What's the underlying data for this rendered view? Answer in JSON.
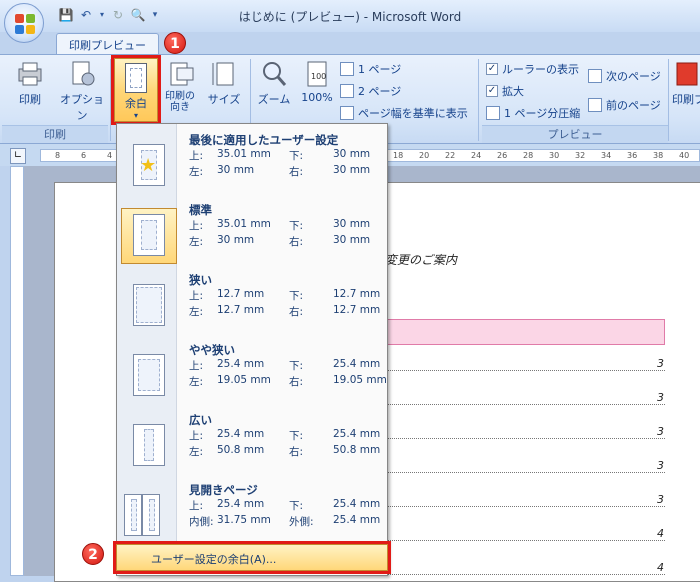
{
  "window": {
    "title": "はじめに (プレビュー) - Microsoft Word"
  },
  "tab": {
    "label": "印刷プレビュー"
  },
  "ribbon": {
    "print_group": {
      "label": "印刷",
      "print": "印刷",
      "options": "オプション"
    },
    "page_setup": {
      "margins": "余白",
      "orientation": "印刷の\n向き",
      "size": "サイズ"
    },
    "zoom_group": {
      "zoom": "ズーム",
      "percent": "100%",
      "one_page": "1 ページ",
      "two_pages": "2 ページ",
      "page_width": "ページ幅を基準に表示"
    },
    "preview_group": {
      "label": "プレビュー",
      "show_ruler": "ルーラーの表示",
      "magnifier": "拡大",
      "shrink_one_page": "1 ページ分圧縮",
      "next_page": "次のページ",
      "prev_page": "前のページ",
      "print_preview_close": "印刷プ"
    }
  },
  "ruler": {
    "ticks": [
      "8",
      "6",
      "4",
      "2",
      "",
      "2",
      "4",
      "6",
      "8",
      "10",
      "12",
      "14",
      "16",
      "18",
      "20",
      "22",
      "24",
      "26",
      "28",
      "30",
      "32",
      "34",
      "36",
      "38",
      "40",
      "42"
    ]
  },
  "document": {
    "notice_text": "ス変更のご案内",
    "toc_numbers": [
      "3",
      "3",
      "3",
      "3",
      "3",
      "4",
      "4"
    ]
  },
  "margins_menu": {
    "options": [
      {
        "title": "最後に適用したユーザー設定",
        "r1": [
          "上:",
          "35.01 mm",
          "下:",
          "30 mm"
        ],
        "r2": [
          "左:",
          "30 mm",
          "右:",
          "30 mm"
        ]
      },
      {
        "title": "標準",
        "r1": [
          "上:",
          "35.01 mm",
          "下:",
          "30 mm"
        ],
        "r2": [
          "左:",
          "30 mm",
          "右:",
          "30 mm"
        ]
      },
      {
        "title": "狭い",
        "r1": [
          "上:",
          "12.7 mm",
          "下:",
          "12.7 mm"
        ],
        "r2": [
          "左:",
          "12.7 mm",
          "右:",
          "12.7 mm"
        ]
      },
      {
        "title": "やや狭い",
        "r1": [
          "上:",
          "25.4 mm",
          "下:",
          "25.4 mm"
        ],
        "r2": [
          "左:",
          "19.05 mm",
          "右:",
          "19.05 mm"
        ]
      },
      {
        "title": "広い",
        "r1": [
          "上:",
          "25.4 mm",
          "下:",
          "25.4 mm"
        ],
        "r2": [
          "左:",
          "50.8 mm",
          "右:",
          "50.8 mm"
        ]
      },
      {
        "title": "見開きページ",
        "r1": [
          "上:",
          "25.4 mm",
          "下:",
          "25.4 mm"
        ],
        "r2": [
          "内側:",
          "31.75 mm",
          "外側:",
          "25.4 mm"
        ]
      }
    ],
    "custom": "ユーザー設定の余白(A)..."
  },
  "badges": {
    "one": "1",
    "two": "2"
  },
  "colors": {
    "highlight": "#e11b17",
    "selected": "#ffd779"
  }
}
